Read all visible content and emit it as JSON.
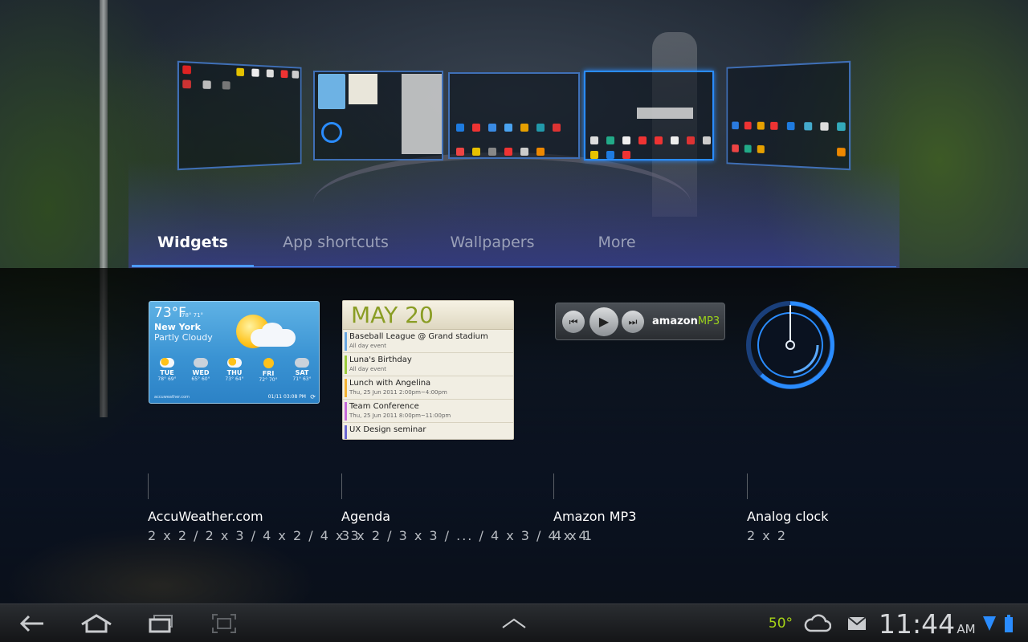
{
  "tabs": [
    {
      "label": "Widgets",
      "active": true
    },
    {
      "label": "App shortcuts",
      "active": false
    },
    {
      "label": "Wallpapers",
      "active": false
    },
    {
      "label": "More",
      "active": false
    }
  ],
  "home_screens": {
    "count": 5,
    "current_index": 3
  },
  "widgets": [
    {
      "name": "AccuWeather.com",
      "sizes": "2 x 2 / 2 x 3 / 4 x 2 / 4 x 3",
      "preview": {
        "temp": "73°F",
        "hilo": "78° 71°",
        "city": "New York",
        "condition": "Partly Cloudy",
        "forecast": [
          {
            "day": "TUE",
            "temps": "78° 69°",
            "icon": "sun-cloud-icon"
          },
          {
            "day": "WED",
            "temps": "65° 60°",
            "icon": "rain-icon"
          },
          {
            "day": "THU",
            "temps": "73° 64°",
            "icon": "sun-cloud-icon"
          },
          {
            "day": "FRI",
            "temps": "72° 70°",
            "icon": "sun-icon"
          },
          {
            "day": "SAT",
            "temps": "71° 63°",
            "icon": "rain-icon"
          }
        ],
        "footer": "accuweather.com",
        "updated": "01/11 03:08 PM"
      }
    },
    {
      "name": "Agenda",
      "sizes": "3 x 2 / 3 x 3 / ... / 4 x 3 / 4 x 4",
      "preview": {
        "date": "MAY 20",
        "events": [
          {
            "title": "Baseball League @ Grand stadium",
            "sub": "All day event",
            "color": "#6aa7e0"
          },
          {
            "title": "Luna's Birthday",
            "sub": "All day event",
            "color": "#9acb3c"
          },
          {
            "title": "Lunch with Angelina",
            "sub": "Thu, 25 Jun 2011 2:00pm~4:00pm",
            "color": "#f2b233"
          },
          {
            "title": "Team Conference",
            "sub": "Thu, 25 Jun 2011 8:00pm~11:00pm",
            "color": "#c46ad8"
          },
          {
            "title": "UX Design seminar",
            "sub": "",
            "color": "#6a66d0"
          }
        ]
      }
    },
    {
      "name": "Amazon MP3",
      "sizes": "4 x 1",
      "preview": {
        "brand": "amazon",
        "brand_suffix": "MP3"
      }
    },
    {
      "name": "Analog clock",
      "sizes": "2 x 2"
    }
  ],
  "system_bar": {
    "temperature": "50°",
    "time": "11:44",
    "ampm": "AM",
    "icons": [
      "back-icon",
      "home-icon",
      "recent-apps-icon",
      "screenshot-icon",
      "up-chevron-icon",
      "cloud-icon",
      "gmail-icon",
      "wifi-icon",
      "battery-icon"
    ]
  },
  "colors": {
    "accent_blue": "#3b86ff",
    "system_temp_green": "#a7d316",
    "agenda_date_green": "#8a9d24"
  }
}
